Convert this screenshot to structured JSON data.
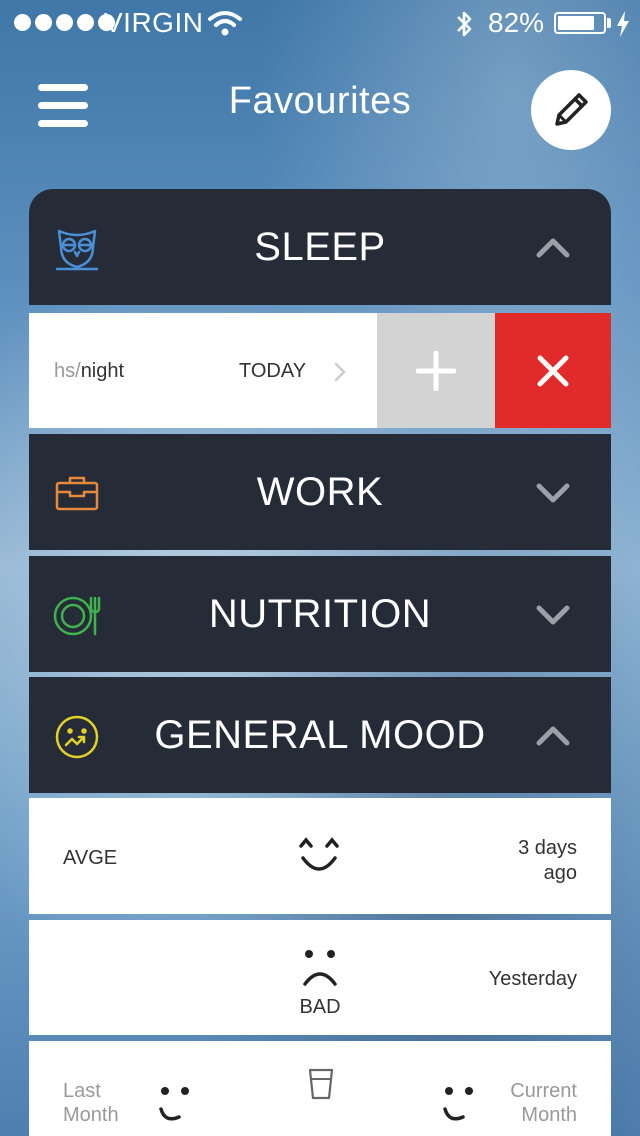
{
  "status_bar": {
    "carrier": "VIRGIN",
    "battery_text": "82%",
    "battery_level": 0.82
  },
  "nav": {
    "title": "Favourites"
  },
  "categories": {
    "sleep": {
      "title": "SLEEP",
      "color": "#4a90d9"
    },
    "work": {
      "title": "WORK",
      "color": "#e8883a"
    },
    "nutrition": {
      "title": "NUTRITION",
      "color": "#3fb24c"
    },
    "mood": {
      "title": "GENERAL MOOD",
      "color": "#e3d028"
    }
  },
  "sleep_row": {
    "unit_faded": "hs/",
    "unit": "night",
    "date_label": "TODAY"
  },
  "mood_entries": {
    "row1": {
      "label": "AVGE",
      "time": "3 days ago",
      "time_line1": "3 days",
      "time_line2": "ago"
    },
    "row2": {
      "mood_label": "BAD",
      "time": "Yesterday"
    },
    "row3": {
      "left_line1": "Last",
      "left_line2": "Month",
      "right_line1": "Current",
      "right_line2": "Month"
    }
  },
  "icons": {
    "menu": "hamburger-icon",
    "edit": "pencil-icon",
    "sleep": "owl-icon",
    "work": "briefcase-icon",
    "nutrition": "plate-icon",
    "mood": "mood-face-icon"
  }
}
